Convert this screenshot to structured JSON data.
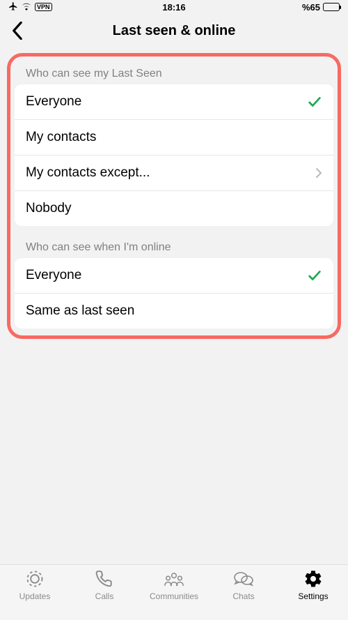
{
  "status": {
    "time": "18:16",
    "battery_text": "%65",
    "vpn": "VPN"
  },
  "nav": {
    "title": "Last seen & online"
  },
  "sections": {
    "lastSeen": {
      "header": "Who can see my Last Seen",
      "options": {
        "everyone": "Everyone",
        "myContacts": "My contacts",
        "myContactsExcept": "My contacts except...",
        "nobody": "Nobody"
      },
      "selected": "everyone",
      "disclosure": "myContactsExcept"
    },
    "online": {
      "header": "Who can see when I'm online",
      "options": {
        "everyone": "Everyone",
        "sameAsLastSeen": "Same as last seen"
      },
      "selected": "everyone"
    }
  },
  "tabs": {
    "updates": "Updates",
    "calls": "Calls",
    "communities": "Communities",
    "chats": "Chats",
    "settings": "Settings",
    "active": "settings"
  },
  "colors": {
    "highlight": "#f76a63",
    "check": "#1fa855"
  }
}
